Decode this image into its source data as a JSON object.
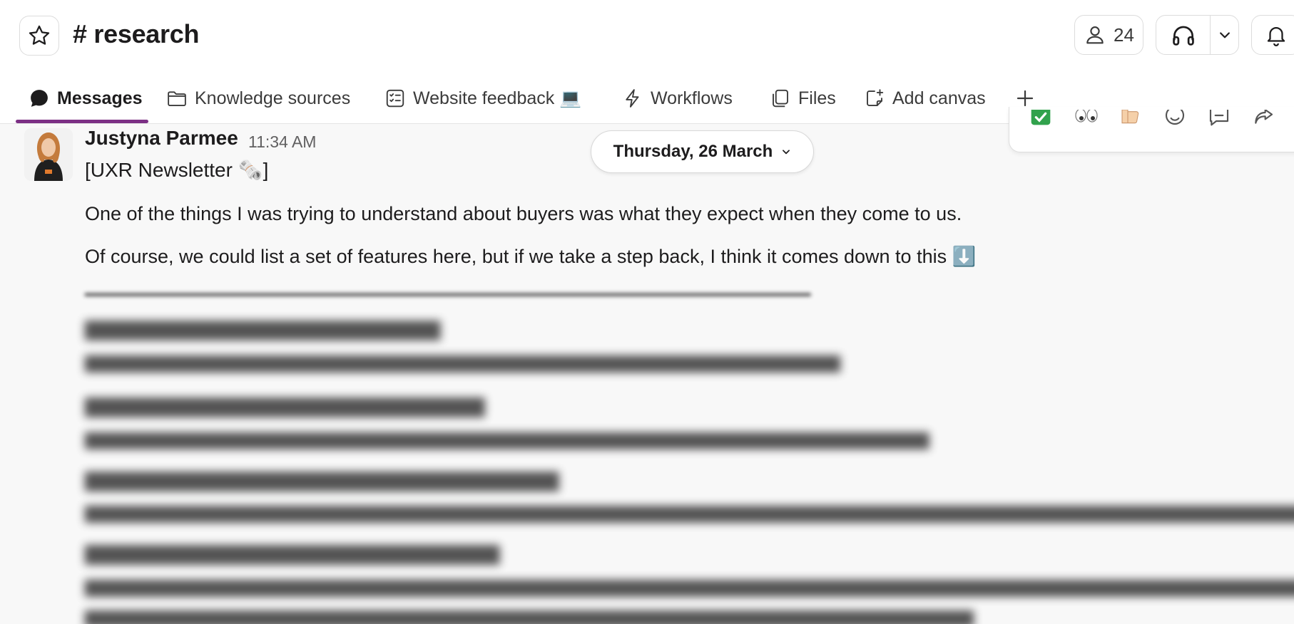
{
  "header": {
    "channel_title": "# research",
    "member_count": "24",
    "icons": {
      "star": "star-icon",
      "members": "person-icon",
      "huddle": "headphones-icon",
      "dropdown": "chevron-down-icon",
      "notifications": "bell-icon"
    }
  },
  "tabs": [
    {
      "label": "Messages",
      "icon": "chat-bubble-icon",
      "active": true
    },
    {
      "label": "Knowledge sources",
      "icon": "folder-icon"
    },
    {
      "label": "Website feedback 💻",
      "icon": "checklist-icon"
    },
    {
      "label": "Workflows",
      "icon": "lightning-icon"
    },
    {
      "label": "Files",
      "icon": "files-icon"
    },
    {
      "label": "Add canvas",
      "icon": "canvas-add-icon"
    },
    {
      "label": "+",
      "icon": "plus-icon"
    }
  ],
  "date_divider": "Thursday, 26 March",
  "reactions": [
    "✅",
    "👀",
    "👍🏻",
    "emoji-add-icon",
    "reply-thread-icon",
    "share-icon"
  ],
  "message": {
    "author": "Justyna Parmee",
    "time": "11:34 AM",
    "title": "[UXR Newsletter 🗞️]",
    "line1": "One of the things I was trying to understand about buyers was what they expect when they come to us.",
    "line2": "Of course, we could list a set of features here, but if we take a step back, I think it comes down to this ⬇️"
  },
  "accent_color": "#7c3085"
}
